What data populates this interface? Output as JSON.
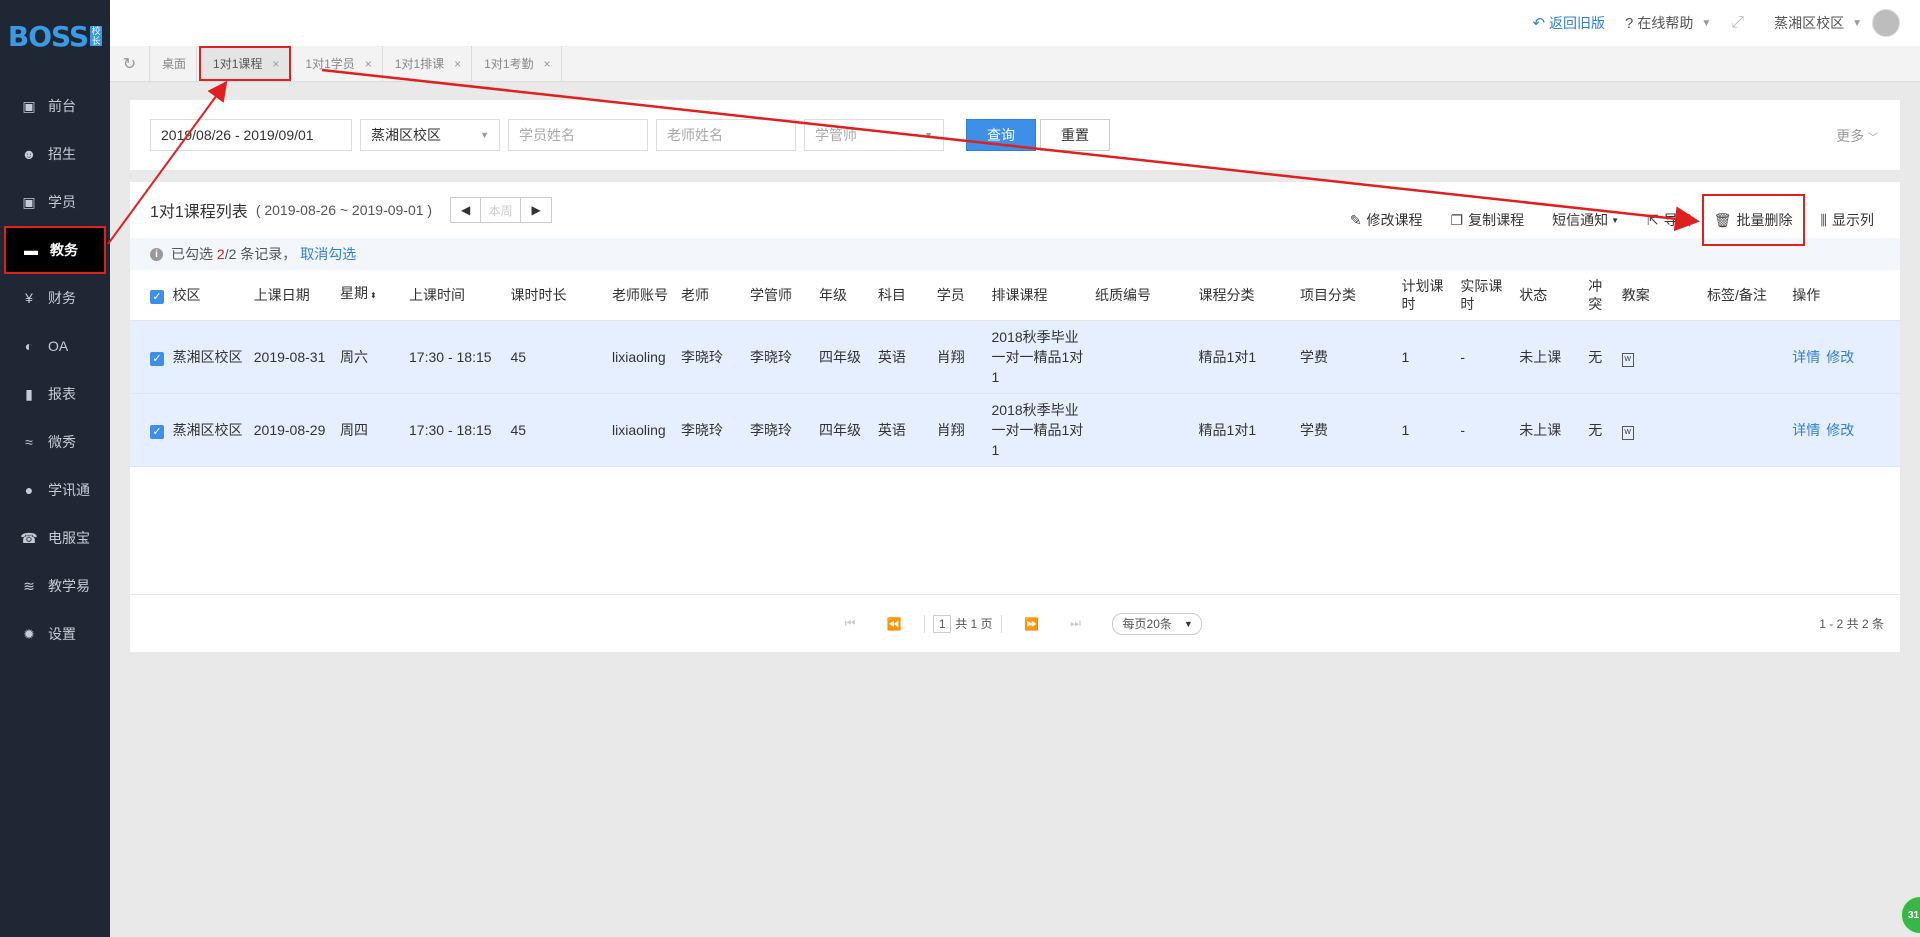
{
  "logo": {
    "text": "BOSS",
    "badge": "校长"
  },
  "sidebar": {
    "items": [
      {
        "label": "前台",
        "icon": "calendar-icon"
      },
      {
        "label": "招生",
        "icon": "user-add-icon"
      },
      {
        "label": "学员",
        "icon": "student-icon"
      },
      {
        "label": "教务",
        "icon": "board-icon",
        "active": true
      },
      {
        "label": "财务",
        "icon": "yen-icon"
      },
      {
        "label": "OA",
        "icon": "toggle-icon"
      },
      {
        "label": "报表",
        "icon": "bar-chart-icon"
      },
      {
        "label": "微秀",
        "icon": "wave-icon"
      },
      {
        "label": "学讯通",
        "icon": "location-icon"
      },
      {
        "label": "电服宝",
        "icon": "phone-icon"
      },
      {
        "label": "教学易",
        "icon": "book-icon"
      },
      {
        "label": "设置",
        "icon": "gear-icon"
      }
    ]
  },
  "topbar": {
    "back_old": "返回旧版",
    "help": "在线帮助",
    "campus": "蒸湘区校区"
  },
  "tabs": [
    {
      "label": "桌面",
      "closable": false
    },
    {
      "label": "1对1课程",
      "closable": true,
      "active": true
    },
    {
      "label": "1对1学员",
      "closable": true
    },
    {
      "label": "1对1排课",
      "closable": true
    },
    {
      "label": "1对1考勤",
      "closable": true
    }
  ],
  "filter": {
    "date_range": "2019/08/26 - 2019/09/01",
    "campus": "蒸湘区校区",
    "student_placeholder": "学员姓名",
    "teacher_placeholder": "老师姓名",
    "manager_placeholder": "学管师",
    "query": "查询",
    "reset": "重置",
    "more": "更多"
  },
  "list": {
    "title": "1对1课程列表",
    "range": "( 2019-08-26 ~ 2019-09-01 )",
    "prev": "◀",
    "this_week": "本周",
    "next": "▶",
    "actions": {
      "edit": "修改课程",
      "copy": "复制课程",
      "sms": "短信通知",
      "export": "导出",
      "batch_delete": "批量删除",
      "columns": "显示列"
    },
    "selection": {
      "prefix": "已勾选",
      "selected": "2",
      "total": "/2 条记录，",
      "cancel": "取消勾选"
    },
    "columns": [
      "校区",
      "上课日期",
      "星期",
      "上课时间",
      "课时时长",
      "老师账号",
      "老师",
      "学管师",
      "年级",
      "科目",
      "学员",
      "排课课程",
      "纸质编号",
      "课程分类",
      "项目分类",
      "计划课时",
      "实际课时",
      "状态",
      "冲突",
      "教案",
      "标签/备注",
      "操作"
    ],
    "rows": [
      {
        "campus": "蒸湘区校区",
        "date": "2019-08-31",
        "weekday": "周六",
        "time": "17:30 - 18:15",
        "duration": "45",
        "account": "lixiaoling",
        "teacher": "李晓玲",
        "manager": "李晓玲",
        "grade": "四年级",
        "subject": "英语",
        "student": "肖翔",
        "course": "2018秋季毕业一对一精品1对1",
        "paper_no": "",
        "category": "精品1对1",
        "project": "学费",
        "planned": "1",
        "actual": "-",
        "status": "未上课",
        "conflict": "无",
        "note": "",
        "detail": "详情",
        "edit": "修改"
      },
      {
        "campus": "蒸湘区校区",
        "date": "2019-08-29",
        "weekday": "周四",
        "time": "17:30 - 18:15",
        "duration": "45",
        "account": "lixiaoling",
        "teacher": "李晓玲",
        "manager": "李晓玲",
        "grade": "四年级",
        "subject": "英语",
        "student": "肖翔",
        "course": "2018秋季毕业一对一精品1对1",
        "paper_no": "",
        "category": "精品1对1",
        "project": "学费",
        "planned": "1",
        "actual": "-",
        "status": "未上课",
        "conflict": "无",
        "note": "",
        "detail": "详情",
        "edit": "修改"
      }
    ]
  },
  "pager": {
    "page": "1",
    "total_pages": "共 1 页",
    "page_size": "每页20条",
    "count": "1 - 2    共 2 条"
  },
  "float_badge": "31"
}
